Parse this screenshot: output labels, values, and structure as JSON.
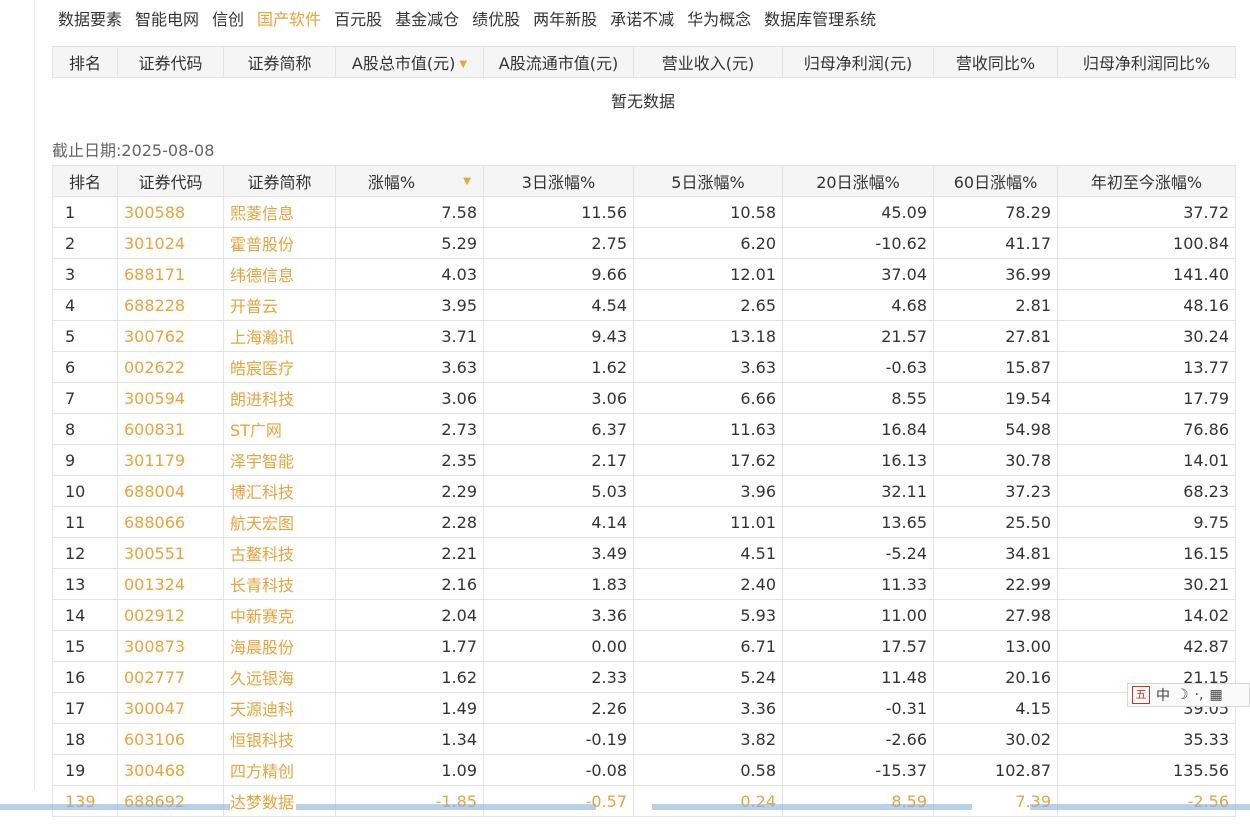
{
  "tabs": [
    {
      "label": "数据要素",
      "active": false
    },
    {
      "label": "智能电网",
      "active": false
    },
    {
      "label": "信创",
      "active": false
    },
    {
      "label": "国产软件",
      "active": true
    },
    {
      "label": "百元股",
      "active": false
    },
    {
      "label": "基金减仓",
      "active": false
    },
    {
      "label": "绩优股",
      "active": false
    },
    {
      "label": "两年新股",
      "active": false
    },
    {
      "label": "承诺不减",
      "active": false
    },
    {
      "label": "华为概念",
      "active": false
    },
    {
      "label": "数据库管理系统",
      "active": false
    }
  ],
  "table1": {
    "headers": [
      "排名",
      "证券代码",
      "证券简称",
      "A股总市值(元)",
      "A股流通市值(元)",
      "营业收入(元)",
      "归母净利润(元)",
      "营收同比%",
      "归母净利润同比%"
    ],
    "empty_text": "暂无数据"
  },
  "cutoff_date": "截止日期:2025-08-08",
  "table2": {
    "headers": [
      "排名",
      "证券代码",
      "证券简称",
      "涨幅%",
      "3日涨幅%",
      "5日涨幅%",
      "20日涨幅%",
      "60日涨幅%",
      "年初至今涨幅%"
    ],
    "rows": [
      [
        "1",
        "300588",
        "熙菱信息",
        "7.58",
        "11.56",
        "10.58",
        "45.09",
        "78.29",
        "37.72"
      ],
      [
        "2",
        "301024",
        "霍普股份",
        "5.29",
        "2.75",
        "6.20",
        "-10.62",
        "41.17",
        "100.84"
      ],
      [
        "3",
        "688171",
        "纬德信息",
        "4.03",
        "9.66",
        "12.01",
        "37.04",
        "36.99",
        "141.40"
      ],
      [
        "4",
        "688228",
        "开普云",
        "3.95",
        "4.54",
        "2.65",
        "4.68",
        "2.81",
        "48.16"
      ],
      [
        "5",
        "300762",
        "上海瀚讯",
        "3.71",
        "9.43",
        "13.18",
        "21.57",
        "27.81",
        "30.24"
      ],
      [
        "6",
        "002622",
        "皓宸医疗",
        "3.63",
        "1.62",
        "3.63",
        "-0.63",
        "15.87",
        "13.77"
      ],
      [
        "7",
        "300594",
        "朗进科技",
        "3.06",
        "3.06",
        "6.66",
        "8.55",
        "19.54",
        "17.79"
      ],
      [
        "8",
        "600831",
        "ST广网",
        "2.73",
        "6.37",
        "11.63",
        "16.84",
        "54.98",
        "76.86"
      ],
      [
        "9",
        "301179",
        "泽宇智能",
        "2.35",
        "2.17",
        "17.62",
        "16.13",
        "30.78",
        "14.01"
      ],
      [
        "10",
        "688004",
        "博汇科技",
        "2.29",
        "5.03",
        "3.96",
        "32.11",
        "37.23",
        "68.23"
      ],
      [
        "11",
        "688066",
        "航天宏图",
        "2.28",
        "4.14",
        "11.01",
        "13.65",
        "25.50",
        "9.75"
      ],
      [
        "12",
        "300551",
        "古鳌科技",
        "2.21",
        "3.49",
        "4.51",
        "-5.24",
        "34.81",
        "16.15"
      ],
      [
        "13",
        "001324",
        "长青科技",
        "2.16",
        "1.83",
        "2.40",
        "11.33",
        "22.99",
        "30.21"
      ],
      [
        "14",
        "002912",
        "中新赛克",
        "2.04",
        "3.36",
        "5.93",
        "11.00",
        "27.98",
        "14.02"
      ],
      [
        "15",
        "300873",
        "海晨股份",
        "1.77",
        "0.00",
        "6.71",
        "17.57",
        "13.00",
        "42.87"
      ],
      [
        "16",
        "002777",
        "久远银海",
        "1.62",
        "2.33",
        "5.24",
        "11.48",
        "20.16",
        "21.15"
      ],
      [
        "17",
        "300047",
        "天源迪科",
        "1.49",
        "2.26",
        "3.36",
        "-0.31",
        "4.15",
        "39.05"
      ],
      [
        "18",
        "603106",
        "恒银科技",
        "1.34",
        "-0.19",
        "3.82",
        "-2.66",
        "30.02",
        "35.33"
      ],
      [
        "19",
        "300468",
        "四方精创",
        "1.09",
        "-0.08",
        "0.58",
        "-15.37",
        "102.87",
        "135.56"
      ]
    ],
    "highlight_row": [
      "139",
      "688692",
      "达梦数据",
      "-1.85",
      "-0.57",
      "0.24",
      "8.59",
      "7.39",
      "-2.56"
    ]
  },
  "ime": {
    "mode_label": "五",
    "lang_label": "中",
    "moon": "☽",
    "dots": "·,",
    "grid": "▦"
  },
  "colors": {
    "accent": "#e8a33d",
    "header_bg": "#f5f5f5",
    "border": "#e3e3e3"
  }
}
